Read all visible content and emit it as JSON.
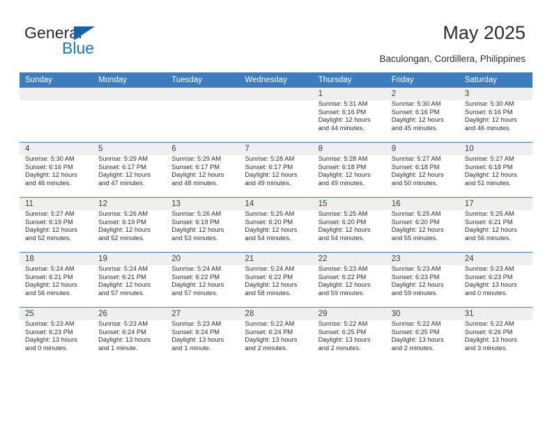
{
  "brand": {
    "name_top": "General",
    "name_bottom": "Blue",
    "accent_color": "#1576c4",
    "triangle_color": "#1263ad"
  },
  "header": {
    "title": "May 2025",
    "subtitle": "Baculongan, Cordillera, Philippines"
  },
  "calendar": {
    "header_bg": "#3c7dc0",
    "header_text_color": "#ffffff",
    "daynum_band_color": "#efefef",
    "weekdays": [
      "Sunday",
      "Monday",
      "Tuesday",
      "Wednesday",
      "Thursday",
      "Friday",
      "Saturday"
    ],
    "weeks": [
      [
        {
          "day": "",
          "empty": true
        },
        {
          "day": "",
          "empty": true
        },
        {
          "day": "",
          "empty": true
        },
        {
          "day": "",
          "empty": true
        },
        {
          "day": "1",
          "sunrise": "Sunrise: 5:31 AM",
          "sunset": "Sunset: 6:16 PM",
          "daylight": "Daylight: 12 hours and 44 minutes."
        },
        {
          "day": "2",
          "sunrise": "Sunrise: 5:30 AM",
          "sunset": "Sunset: 6:16 PM",
          "daylight": "Daylight: 12 hours and 45 minutes."
        },
        {
          "day": "3",
          "sunrise": "Sunrise: 5:30 AM",
          "sunset": "Sunset: 6:16 PM",
          "daylight": "Daylight: 12 hours and 46 minutes."
        }
      ],
      [
        {
          "day": "4",
          "sunrise": "Sunrise: 5:30 AM",
          "sunset": "Sunset: 6:16 PM",
          "daylight": "Daylight: 12 hours and 46 minutes."
        },
        {
          "day": "5",
          "sunrise": "Sunrise: 5:29 AM",
          "sunset": "Sunset: 6:17 PM",
          "daylight": "Daylight: 12 hours and 47 minutes."
        },
        {
          "day": "6",
          "sunrise": "Sunrise: 5:29 AM",
          "sunset": "Sunset: 6:17 PM",
          "daylight": "Daylight: 12 hours and 48 minutes."
        },
        {
          "day": "7",
          "sunrise": "Sunrise: 5:28 AM",
          "sunset": "Sunset: 6:17 PM",
          "daylight": "Daylight: 12 hours and 49 minutes."
        },
        {
          "day": "8",
          "sunrise": "Sunrise: 5:28 AM",
          "sunset": "Sunset: 6:18 PM",
          "daylight": "Daylight: 12 hours and 49 minutes."
        },
        {
          "day": "9",
          "sunrise": "Sunrise: 5:27 AM",
          "sunset": "Sunset: 6:18 PM",
          "daylight": "Daylight: 12 hours and 50 minutes."
        },
        {
          "day": "10",
          "sunrise": "Sunrise: 5:27 AM",
          "sunset": "Sunset: 6:18 PM",
          "daylight": "Daylight: 12 hours and 51 minutes."
        }
      ],
      [
        {
          "day": "11",
          "sunrise": "Sunrise: 5:27 AM",
          "sunset": "Sunset: 6:19 PM",
          "daylight": "Daylight: 12 hours and 52 minutes."
        },
        {
          "day": "12",
          "sunrise": "Sunrise: 5:26 AM",
          "sunset": "Sunset: 6:19 PM",
          "daylight": "Daylight: 12 hours and 52 minutes."
        },
        {
          "day": "13",
          "sunrise": "Sunrise: 5:26 AM",
          "sunset": "Sunset: 6:19 PM",
          "daylight": "Daylight: 12 hours and 53 minutes."
        },
        {
          "day": "14",
          "sunrise": "Sunrise: 5:25 AM",
          "sunset": "Sunset: 6:20 PM",
          "daylight": "Daylight: 12 hours and 54 minutes."
        },
        {
          "day": "15",
          "sunrise": "Sunrise: 5:25 AM",
          "sunset": "Sunset: 6:20 PM",
          "daylight": "Daylight: 12 hours and 54 minutes."
        },
        {
          "day": "16",
          "sunrise": "Sunrise: 5:25 AM",
          "sunset": "Sunset: 6:20 PM",
          "daylight": "Daylight: 12 hours and 55 minutes."
        },
        {
          "day": "17",
          "sunrise": "Sunrise: 5:25 AM",
          "sunset": "Sunset: 6:21 PM",
          "daylight": "Daylight: 12 hours and 56 minutes."
        }
      ],
      [
        {
          "day": "18",
          "sunrise": "Sunrise: 5:24 AM",
          "sunset": "Sunset: 6:21 PM",
          "daylight": "Daylight: 12 hours and 56 minutes."
        },
        {
          "day": "19",
          "sunrise": "Sunrise: 5:24 AM",
          "sunset": "Sunset: 6:21 PM",
          "daylight": "Daylight: 12 hours and 57 minutes."
        },
        {
          "day": "20",
          "sunrise": "Sunrise: 5:24 AM",
          "sunset": "Sunset: 6:22 PM",
          "daylight": "Daylight: 12 hours and 57 minutes."
        },
        {
          "day": "21",
          "sunrise": "Sunrise: 5:24 AM",
          "sunset": "Sunset: 6:22 PM",
          "daylight": "Daylight: 12 hours and 58 minutes."
        },
        {
          "day": "22",
          "sunrise": "Sunrise: 5:23 AM",
          "sunset": "Sunset: 6:22 PM",
          "daylight": "Daylight: 12 hours and 59 minutes."
        },
        {
          "day": "23",
          "sunrise": "Sunrise: 5:23 AM",
          "sunset": "Sunset: 6:23 PM",
          "daylight": "Daylight: 12 hours and 59 minutes."
        },
        {
          "day": "24",
          "sunrise": "Sunrise: 5:23 AM",
          "sunset": "Sunset: 6:23 PM",
          "daylight": "Daylight: 13 hours and 0 minutes."
        }
      ],
      [
        {
          "day": "25",
          "sunrise": "Sunrise: 5:23 AM",
          "sunset": "Sunset: 6:23 PM",
          "daylight": "Daylight: 13 hours and 0 minutes."
        },
        {
          "day": "26",
          "sunrise": "Sunrise: 5:23 AM",
          "sunset": "Sunset: 6:24 PM",
          "daylight": "Daylight: 13 hours and 1 minute."
        },
        {
          "day": "27",
          "sunrise": "Sunrise: 5:23 AM",
          "sunset": "Sunset: 6:24 PM",
          "daylight": "Daylight: 13 hours and 1 minute."
        },
        {
          "day": "28",
          "sunrise": "Sunrise: 5:22 AM",
          "sunset": "Sunset: 6:24 PM",
          "daylight": "Daylight: 13 hours and 2 minutes."
        },
        {
          "day": "29",
          "sunrise": "Sunrise: 5:22 AM",
          "sunset": "Sunset: 6:25 PM",
          "daylight": "Daylight: 13 hours and 2 minutes."
        },
        {
          "day": "30",
          "sunrise": "Sunrise: 5:22 AM",
          "sunset": "Sunset: 6:25 PM",
          "daylight": "Daylight: 13 hours and 2 minutes."
        },
        {
          "day": "31",
          "sunrise": "Sunrise: 5:22 AM",
          "sunset": "Sunset: 6:26 PM",
          "daylight": "Daylight: 13 hours and 3 minutes."
        }
      ]
    ]
  }
}
